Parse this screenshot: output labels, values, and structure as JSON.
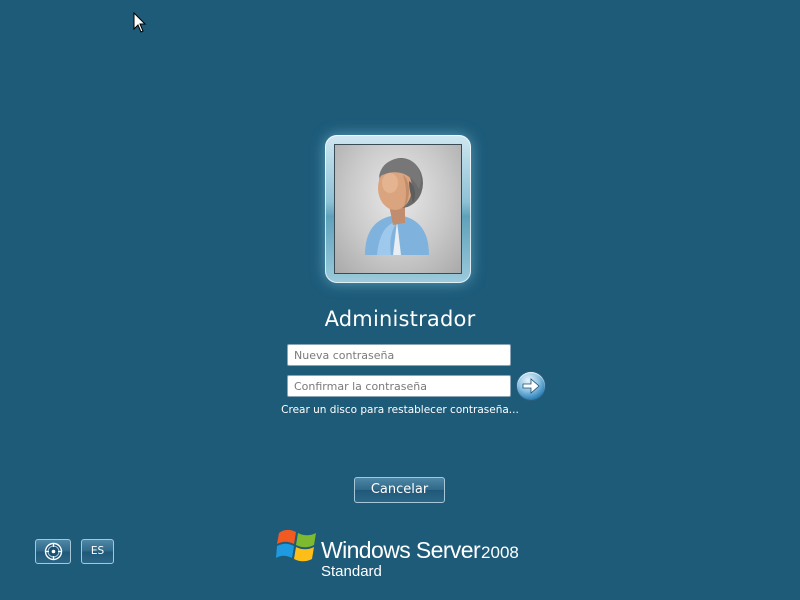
{
  "login": {
    "username": "Administrador",
    "new_password_placeholder": "Nueva contraseña",
    "confirm_password_placeholder": "Confirmar la contraseña",
    "reset_disk_link": "Crear un disco para restablecer contraseña...",
    "cancel_label": "Cancelar"
  },
  "bottom_bar": {
    "ease_of_access_icon": "ease-of-access-icon",
    "language_label": "ES"
  },
  "branding": {
    "product_name": "Windows Server",
    "version": "2008",
    "edition": "Standard",
    "logo_icon": "windows-flag-icon"
  },
  "colors": {
    "background": "#1d5b79",
    "button_border": "#a7c7d8",
    "go_button": "#2b7fb8"
  }
}
